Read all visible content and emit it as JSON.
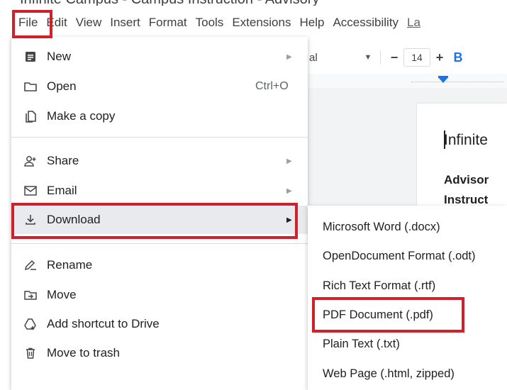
{
  "title_strip": "Infinite Campus - Campus Instruction - Advisory",
  "menubar": {
    "items": [
      "File",
      "Edit",
      "View",
      "Insert",
      "Format",
      "Tools",
      "Extensions",
      "Help",
      "Accessibility",
      "La"
    ]
  },
  "toolbar": {
    "font_name": "al",
    "font_size": "14",
    "minus": "−",
    "plus": "+",
    "bold": "B"
  },
  "document": {
    "title": "Infinite",
    "sub1": "Advisor",
    "sub2": "Instruct"
  },
  "file_menu": {
    "items": [
      {
        "label": "New",
        "icon": "document-icon",
        "has_submenu": true
      },
      {
        "label": "Open",
        "icon": "folder-icon",
        "shortcut": "Ctrl+O"
      },
      {
        "label": "Make a copy",
        "icon": "copy-icon"
      },
      {
        "label": "Share",
        "icon": "share-person-icon",
        "has_submenu": true
      },
      {
        "label": "Email",
        "icon": "email-icon",
        "has_submenu": true
      },
      {
        "label": "Download",
        "icon": "download-icon",
        "has_submenu": true,
        "highlighted": true
      },
      {
        "label": "Rename",
        "icon": "rename-icon"
      },
      {
        "label": "Move",
        "icon": "move-icon"
      },
      {
        "label": "Add shortcut to Drive",
        "icon": "drive-shortcut-icon"
      },
      {
        "label": "Move to trash",
        "icon": "trash-icon"
      }
    ]
  },
  "download_menu": {
    "items": [
      {
        "label": "Microsoft Word (.docx)"
      },
      {
        "label": "OpenDocument Format (.odt)"
      },
      {
        "label": "Rich Text Format (.rtf)"
      },
      {
        "label": "PDF Document (.pdf)",
        "highlighted": true
      },
      {
        "label": "Plain Text (.txt)"
      },
      {
        "label": "Web Page (.html, zipped)"
      }
    ]
  },
  "colors": {
    "annotation_red": "#d0202b",
    "accent_blue": "#1a73e8",
    "hover_gray": "#e8eaed"
  }
}
